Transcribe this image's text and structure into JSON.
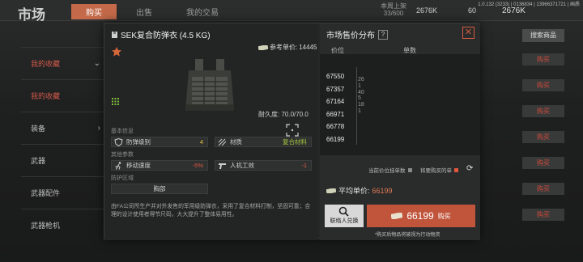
{
  "background": {
    "title": "市场",
    "tabs": [
      "购买",
      "出售",
      "我的交易"
    ],
    "capacity_label": "本周上架",
    "capacity_value": "33/600",
    "currency1": "2676K",
    "currency2": "60",
    "currency3": "2676K",
    "version": "1.0.132 (3233) | 0136834 | 13966371721 | 画质",
    "sidebar": [
      {
        "label": "我的收藏",
        "highlight": true
      },
      {
        "label": "我的收藏",
        "highlight": true
      },
      {
        "label": "装备"
      },
      {
        "label": "武器"
      },
      {
        "label": "武器配件"
      },
      {
        "label": "武器枪机"
      }
    ],
    "search_button": "搜索商品",
    "right_buttons": [
      "购买",
      "购买",
      "购买",
      "购买",
      "购买",
      "购买",
      "购买"
    ]
  },
  "item": {
    "name": "SEK复合防弹衣 (4.5 KG)",
    "ref_price_label": "参考单价:",
    "ref_price": "14445",
    "durability": "耐久度: 70.0/70.0",
    "basic_info_label": "基本信息",
    "armor_level_label": "防弹级别",
    "armor_level_value": "4",
    "material_label": "材质",
    "material_value": "复合材料",
    "other_params_label": "其他参数",
    "move_speed_label": "移动速度",
    "move_speed_value": "-5%",
    "ergonomics_label": "人机工效",
    "ergonomics_value": "-1",
    "protect_area_label": "防护区域",
    "protect_area_value": "胸部",
    "description": "由FA公司所生产并对外发售的军用级防弹衣，采用了复合材料打制，坚固可靠；合理的设计使用者得节尺码，大大提升了整体易用性。"
  },
  "market": {
    "title": "市场售价分布",
    "help": "?",
    "price_header": "价位",
    "qty_header": "单数",
    "chart_data": {
      "type": "bar",
      "categories": [
        "67550",
        "67357",
        "67164",
        "66971",
        "66778",
        "66199"
      ],
      "values": [
        26,
        1,
        40,
        5,
        18,
        1
      ]
    },
    "legend_current": "当前价位挂单数",
    "legend_mine": "将要购买的单",
    "legend_colors": {
      "current": "#8a8a8a",
      "mine": "#e0573e"
    },
    "avg_label": "平均单价:",
    "avg_value": "66199",
    "exchange_label": "联络人兑换",
    "buy_price": "66199",
    "buy_label": "购买",
    "note": "*购买后物品将被视为行动物资"
  }
}
